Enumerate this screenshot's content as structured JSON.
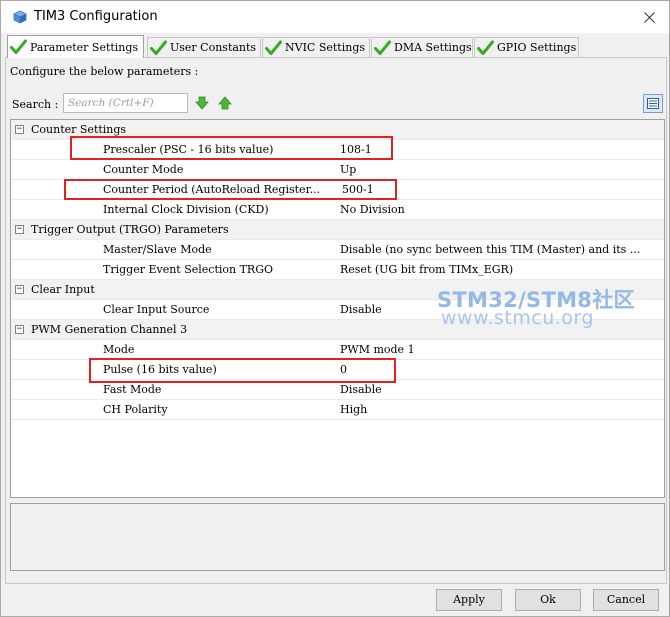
{
  "window": {
    "title": "TIM3 Configuration",
    "close_glyph": "✕"
  },
  "tabs": [
    {
      "label": "Parameter Settings",
      "active": true,
      "icon": "check-icon"
    },
    {
      "label": "User Constants",
      "active": false,
      "icon": "check-icon"
    },
    {
      "label": "NVIC Settings",
      "active": false,
      "icon": "check-icon"
    },
    {
      "label": "DMA Settings",
      "active": false,
      "icon": "check-icon"
    },
    {
      "label": "GPIO Settings",
      "active": false,
      "icon": "check-icon"
    }
  ],
  "panel": {
    "configure_label": "Configure the below parameters :",
    "search_label": "Search :",
    "search_placeholder": "Search (Crtl+F)"
  },
  "groups": [
    {
      "name": "Counter Settings",
      "expanded": true,
      "params": [
        {
          "name": "Prescaler (PSC - 16 bits value)",
          "value": "108-1",
          "highlighted": true
        },
        {
          "name": "Counter Mode",
          "value": "Up",
          "highlighted": false
        },
        {
          "name": "Counter Period (AutoReload Register...",
          "value": "500-1",
          "highlighted": true
        },
        {
          "name": "Internal Clock Division (CKD)",
          "value": "No Division",
          "highlighted": false
        }
      ]
    },
    {
      "name": "Trigger Output (TRGO) Parameters",
      "expanded": true,
      "params": [
        {
          "name": "Master/Slave Mode",
          "value": "Disable (no sync between this TIM (Master) and its ...",
          "highlighted": false
        },
        {
          "name": "Trigger Event Selection TRGO",
          "value": "Reset (UG bit from TIMx_EGR)",
          "highlighted": false
        }
      ]
    },
    {
      "name": "Clear Input",
      "expanded": true,
      "params": [
        {
          "name": "Clear Input Source",
          "value": "Disable",
          "highlighted": false
        }
      ]
    },
    {
      "name": "PWM Generation Channel 3",
      "expanded": true,
      "params": [
        {
          "name": "Mode",
          "value": "PWM mode 1",
          "highlighted": false
        },
        {
          "name": "Pulse (16 bits value)",
          "value": "0",
          "highlighted": true
        },
        {
          "name": "Fast Mode",
          "value": "Disable",
          "highlighted": false
        },
        {
          "name": "CH Polarity",
          "value": "High",
          "highlighted": false
        }
      ]
    }
  ],
  "buttons": {
    "apply": "Apply",
    "ok": "Ok",
    "cancel": "Cancel"
  },
  "watermark": {
    "line1": "STM32/STM8社区",
    "line2": "www.stmcu.org"
  },
  "colors": {
    "check_green": "#3aa829",
    "highlight_red": "#e52020",
    "watermark_blue": "#93b9e6"
  }
}
